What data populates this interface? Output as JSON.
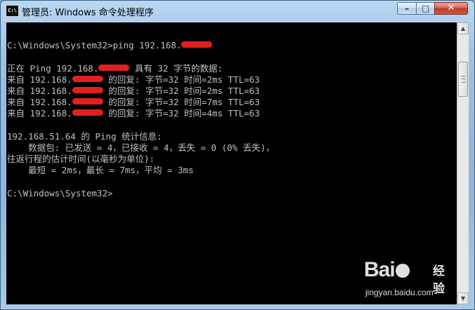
{
  "window": {
    "icon_text": "C:\\",
    "title": "管理员: Windows 命令处理程序",
    "controls": {
      "minimize": "–",
      "maximize": "□",
      "close": "✕"
    }
  },
  "console": {
    "prompt1": "C:\\Windows\\System32>",
    "command": "ping 192.168.",
    "ping_intro_prefix": "正在 Ping 192.168.",
    "ping_intro_suffix": " 具有 32 字节的数据:",
    "reply_prefix": "来自 192.168.",
    "replies": [
      "的回复: 字节=32 时间=2ms TTL=63",
      "的回复: 字节=32 时间=2ms TTL=63",
      "的回复: 字节=32 时间=7ms TTL=63",
      "的回复: 字节=32 时间=4ms TTL=63"
    ],
    "stats_header": "192.168.51.64 的 Ping 统计信息:",
    "packets": "    数据包: 已发送 = 4，已接收 = 4，丢失 = 0 (0% 丢失)，",
    "rtt_header": "往返行程的估计时间(以毫秒为单位):",
    "rtt": "    最短 = 2ms，最长 = 7ms，平均 = 3ms",
    "prompt2": "C:\\Windows\\System32>"
  },
  "watermark": {
    "logo_left": "Bai",
    "logo_right": "经验",
    "url": "jingyan.baidu.com"
  },
  "colors": {
    "console_bg": "#000000",
    "console_text": "#c0c0c0",
    "redaction": "#e02020"
  }
}
